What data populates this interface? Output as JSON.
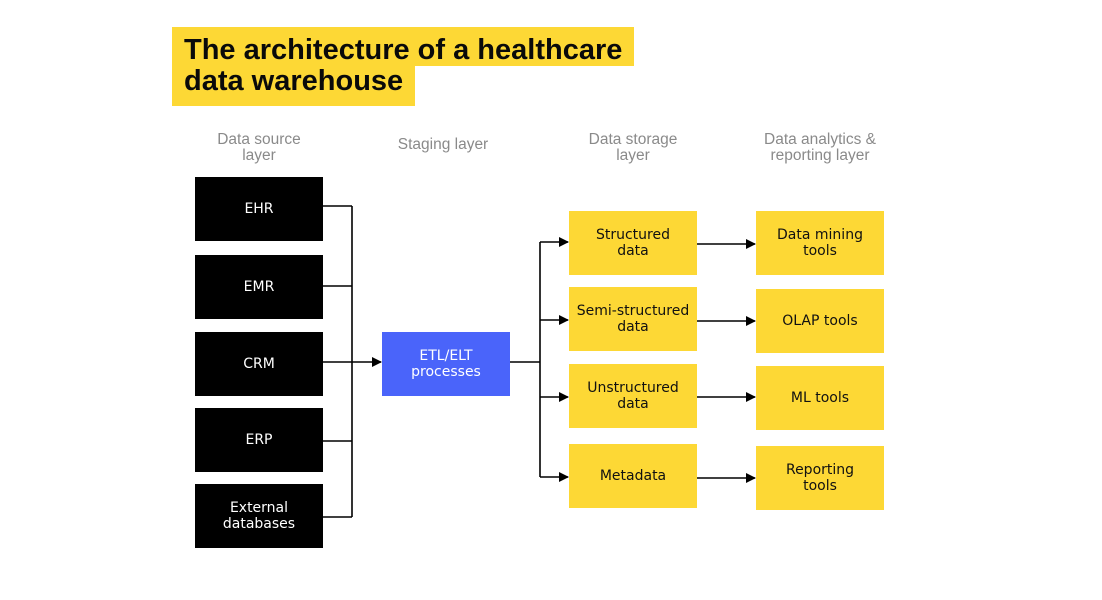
{
  "title": {
    "line1": "The architecture of a healthcare",
    "line2": "data warehouse",
    "highlight_color": "#fdd835"
  },
  "columns": [
    {
      "line1": "Data source",
      "line2": "layer"
    },
    {
      "line1": "Staging layer",
      "line2": ""
    },
    {
      "line1": "Data storage",
      "line2": "layer"
    },
    {
      "line1": "Data analytics &",
      "line2": "reporting layer"
    }
  ],
  "sources": [
    {
      "line1": "EHR",
      "line2": ""
    },
    {
      "line1": "EMR",
      "line2": ""
    },
    {
      "line1": "CRM",
      "line2": ""
    },
    {
      "line1": "ERP",
      "line2": ""
    },
    {
      "line1": "External",
      "line2": "databases"
    }
  ],
  "staging": {
    "line1": "ETL/ELT",
    "line2": "processes"
  },
  "storage": [
    {
      "line1": "Structured",
      "line2": "data"
    },
    {
      "line1": "Semi-structured",
      "line2": "data"
    },
    {
      "line1": "Unstructured",
      "line2": "data"
    },
    {
      "line1": "Metadata",
      "line2": ""
    }
  ],
  "tools": [
    {
      "line1": "Data mining",
      "line2": "tools"
    },
    {
      "line1": "OLAP tools",
      "line2": ""
    },
    {
      "line1": "ML tools",
      "line2": ""
    },
    {
      "line1": "Reporting",
      "line2": "tools"
    }
  ],
  "colors": {
    "source_fill": "#000000",
    "staging_fill": "#4a64fa",
    "storage_fill": "#fdd835",
    "tool_fill": "#fdd835",
    "connector": "#000000",
    "column_header": "#8a8a8a"
  }
}
